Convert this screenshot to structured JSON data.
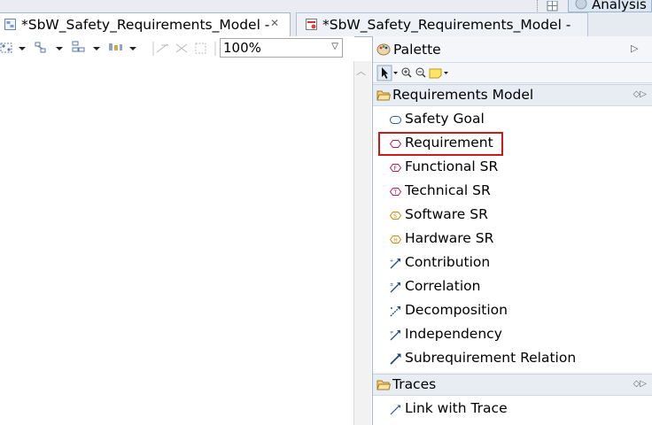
{
  "perspective_bar": {
    "analysis_label": "Analysis"
  },
  "editor_tabs": [
    {
      "label": "*SbW_Safety_Requirements_Model -",
      "active": true
    },
    {
      "label": "*SbW_Safety_Requirements_Model -",
      "active": false
    }
  ],
  "toolbar": {
    "zoom_value": "100%"
  },
  "palette": {
    "title": "Palette",
    "drawers": [
      {
        "label": "Requirements Model",
        "items": [
          {
            "label": "Safety Goal",
            "icon": "safety-goal-icon"
          },
          {
            "label": "Requirement",
            "icon": "requirement-icon",
            "highlighted": true
          },
          {
            "label": "Functional SR",
            "icon": "functional-sr-icon"
          },
          {
            "label": "Technical SR",
            "icon": "technical-sr-icon"
          },
          {
            "label": "Software SR",
            "icon": "software-sr-icon"
          },
          {
            "label": "Hardware SR",
            "icon": "hardware-sr-icon"
          },
          {
            "label": "Contribution",
            "icon": "contribution-icon"
          },
          {
            "label": "Correlation",
            "icon": "correlation-icon"
          },
          {
            "label": "Decomposition",
            "icon": "decomposition-icon"
          },
          {
            "label": "Independency",
            "icon": "independency-icon"
          },
          {
            "label": "Subrequirement Relation",
            "icon": "subrequirement-relation-icon"
          }
        ]
      },
      {
        "label": "Traces",
        "items": [
          {
            "label": "Link with Trace",
            "icon": "link-with-trace-icon"
          }
        ]
      }
    ]
  },
  "colors": {
    "highlight_border": "#d01818",
    "requirement_pink": "#c2185b",
    "sr_orange": "#d08a10",
    "relation_blue": "#1f4e8c"
  }
}
